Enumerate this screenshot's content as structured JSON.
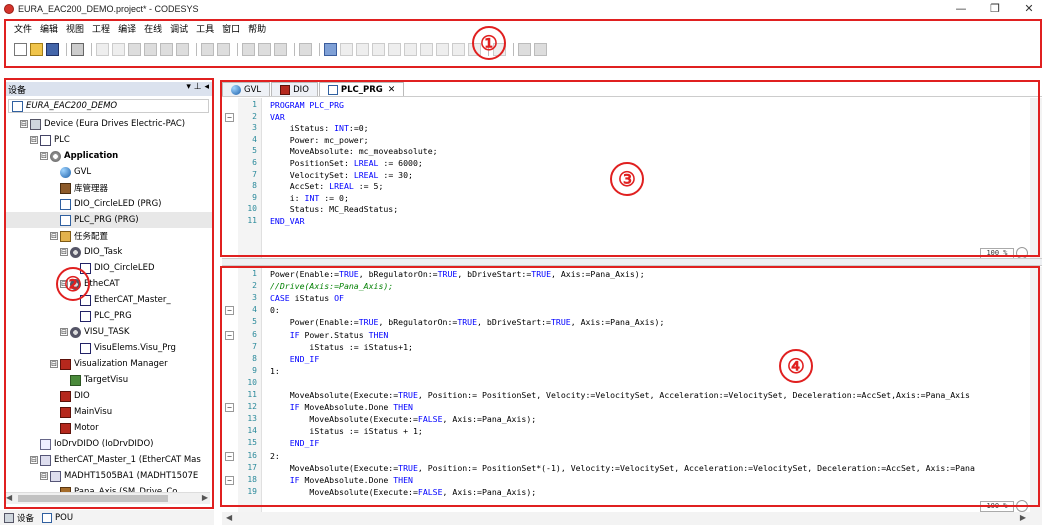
{
  "window": {
    "title": "EURA_EAC200_DEMO.project* - CODESYS",
    "min_glyph": "—",
    "max_glyph": "❐",
    "close_glyph": "✕"
  },
  "menu": [
    "文件",
    "编辑",
    "视图",
    "工程",
    "编译",
    "在线",
    "调试",
    "工具",
    "窗口",
    "帮助"
  ],
  "annotations": [
    "①",
    "②",
    "③",
    "④"
  ],
  "devices_panel": {
    "title": "设备",
    "header_buttons": "▾ ⊥ ◂",
    "root": "EURA_EAC200_DEMO",
    "tree": [
      {
        "label": "Device (Eura Drives Electric-PAC)",
        "level": 1,
        "icon": "device-icon",
        "exp": "⊟"
      },
      {
        "label": "PLC",
        "level": 2,
        "icon": "plc-icon",
        "exp": "⊟"
      },
      {
        "label": "Application",
        "level": 3,
        "icon": "application-icon",
        "exp": "⊟",
        "bold": true
      },
      {
        "label": "GVL",
        "level": 4,
        "icon": "globe-icon",
        "exp": ""
      },
      {
        "label": "库管理器",
        "level": 4,
        "icon": "library-icon",
        "exp": ""
      },
      {
        "label": "DIO_CircleLED (PRG)",
        "level": 4,
        "icon": "pou-icon",
        "exp": ""
      },
      {
        "label": "PLC_PRG (PRG)",
        "level": 4,
        "icon": "pou-icon",
        "exp": "",
        "selected": true
      },
      {
        "label": "任务配置",
        "level": 4,
        "icon": "task-config-icon",
        "exp": "⊟"
      },
      {
        "label": "DIO_Task",
        "level": 5,
        "icon": "task-gear-icon",
        "exp": "⊟"
      },
      {
        "label": "DIO_CircleLED",
        "level": 6,
        "icon": "program-call-icon",
        "exp": ""
      },
      {
        "label": "EtheCAT",
        "level": 5,
        "icon": "task-gear-icon",
        "exp": "⊟"
      },
      {
        "label": "EtherCAT_Master_",
        "level": 6,
        "icon": "program-call-icon",
        "exp": ""
      },
      {
        "label": "PLC_PRG",
        "level": 6,
        "icon": "program-call-icon",
        "exp": ""
      },
      {
        "label": "VISU_TASK",
        "level": 5,
        "icon": "task-gear-icon",
        "exp": "⊟"
      },
      {
        "label": "VisuElems.Visu_Prg",
        "level": 6,
        "icon": "program-call-icon",
        "exp": ""
      },
      {
        "label": "Visualization Manager",
        "level": 4,
        "icon": "visu-manager-icon",
        "exp": "⊟"
      },
      {
        "label": "TargetVisu",
        "level": 5,
        "icon": "target-visu-icon",
        "exp": ""
      },
      {
        "label": "DIO",
        "level": 4,
        "icon": "visu-icon",
        "exp": ""
      },
      {
        "label": "MainVisu",
        "level": 4,
        "icon": "visu-icon",
        "exp": ""
      },
      {
        "label": "Motor",
        "level": 4,
        "icon": "visu-icon",
        "exp": ""
      },
      {
        "label": "IoDrvDIDO (IoDrvDIDO)",
        "level": 2,
        "icon": "io-driver-icon",
        "exp": ""
      },
      {
        "label": "EtherCAT_Master_1 (EtherCAT Mas",
        "level": 2,
        "icon": "ethercat-master-icon",
        "exp": "⊟"
      },
      {
        "label": "MADHT1505BA1 (MADHT1507E",
        "level": 3,
        "icon": "ethercat-slave-icon",
        "exp": "⊟"
      },
      {
        "label": "Pana_Axis (SM_Drive_Co",
        "level": 4,
        "icon": "axis-icon",
        "exp": ""
      }
    ],
    "bottom_tabs": [
      {
        "label": "设备",
        "icon": "devices-tab-icon"
      },
      {
        "label": "POU",
        "icon": "pou-tab-icon"
      }
    ]
  },
  "editor": {
    "tabs": [
      {
        "label": "GVL",
        "icon": "globe-icon",
        "active": false
      },
      {
        "label": "DIO",
        "icon": "visu-icon",
        "active": false
      },
      {
        "label": "PLC_PRG",
        "icon": "pou-icon",
        "active": true,
        "close": "✕"
      }
    ],
    "decl_zoom": "100 %",
    "impl_zoom": "100 %",
    "declaration_lines": [
      [
        {
          "t": "PROGRAM PLC_PRG",
          "c": "kw"
        }
      ],
      [
        {
          "t": "VAR",
          "c": "kw"
        }
      ],
      [
        {
          "t": "    iStatus: ",
          "c": ""
        },
        {
          "t": "INT",
          "c": "kw"
        },
        {
          "t": ":=0;",
          "c": ""
        }
      ],
      [
        {
          "t": "    Power: mc_power;",
          "c": ""
        }
      ],
      [
        {
          "t": "    MoveAbsolute: mc_moveabsolute;",
          "c": ""
        }
      ],
      [
        {
          "t": "    PositionSet: ",
          "c": ""
        },
        {
          "t": "LREAL",
          "c": "kw"
        },
        {
          "t": " := 6000;",
          "c": ""
        }
      ],
      [
        {
          "t": "    VelocitySet: ",
          "c": ""
        },
        {
          "t": "LREAL",
          "c": "kw"
        },
        {
          "t": " := 30;",
          "c": ""
        }
      ],
      [
        {
          "t": "    AccSet: ",
          "c": ""
        },
        {
          "t": "LREAL",
          "c": "kw"
        },
        {
          "t": " := 5;",
          "c": ""
        }
      ],
      [
        {
          "t": "    i: ",
          "c": ""
        },
        {
          "t": "INT",
          "c": "kw"
        },
        {
          "t": " := 0;",
          "c": ""
        }
      ],
      [
        {
          "t": "    Status: MC_ReadStatus;",
          "c": ""
        }
      ],
      [
        {
          "t": "END_VAR",
          "c": "kw"
        }
      ]
    ],
    "implementation_lines": [
      [
        {
          "t": "Power(Enable:=",
          "c": ""
        },
        {
          "t": "TRUE",
          "c": "kw"
        },
        {
          "t": ", bRegulatorOn:=",
          "c": ""
        },
        {
          "t": "TRUE",
          "c": "kw"
        },
        {
          "t": ", bDriveStart:=",
          "c": ""
        },
        {
          "t": "TRUE",
          "c": "kw"
        },
        {
          "t": ", Axis:=Pana_Axis);",
          "c": ""
        }
      ],
      [
        {
          "t": "//Drive(Axis:=Pana_Axis);",
          "c": "cm"
        }
      ],
      [
        {
          "t": "CASE",
          "c": "kw"
        },
        {
          "t": " iStatus ",
          "c": ""
        },
        {
          "t": "OF",
          "c": "kw"
        }
      ],
      [
        {
          "t": "0:",
          "c": ""
        }
      ],
      [
        {
          "t": "    Power(Enable:=",
          "c": ""
        },
        {
          "t": "TRUE",
          "c": "kw"
        },
        {
          "t": ", bRegulatorOn:=",
          "c": ""
        },
        {
          "t": "TRUE",
          "c": "kw"
        },
        {
          "t": ", bDriveStart:=",
          "c": ""
        },
        {
          "t": "TRUE",
          "c": "kw"
        },
        {
          "t": ", Axis:=Pana_Axis);",
          "c": ""
        }
      ],
      [
        {
          "t": "    ",
          "c": ""
        },
        {
          "t": "IF",
          "c": "kw"
        },
        {
          "t": " Power.Status ",
          "c": ""
        },
        {
          "t": "THEN",
          "c": "kw"
        }
      ],
      [
        {
          "t": "        iStatus := iStatus+1;",
          "c": ""
        }
      ],
      [
        {
          "t": "    ",
          "c": ""
        },
        {
          "t": "END_IF",
          "c": "kw"
        }
      ],
      [
        {
          "t": "1:",
          "c": ""
        }
      ],
      [
        {
          "t": "",
          "c": ""
        }
      ],
      [
        {
          "t": "    MoveAbsolute(Execute:=",
          "c": ""
        },
        {
          "t": "TRUE",
          "c": "kw"
        },
        {
          "t": ", Position:= PositionSet, Velocity:=VelocitySet, Acceleration:=VelocitySet, Deceleration:=AccSet,Axis:=Pana_Axis",
          "c": ""
        }
      ],
      [
        {
          "t": "    ",
          "c": ""
        },
        {
          "t": "IF",
          "c": "kw"
        },
        {
          "t": " MoveAbsolute.Done ",
          "c": ""
        },
        {
          "t": "THEN",
          "c": "kw"
        }
      ],
      [
        {
          "t": "        MoveAbsolute(Execute:=",
          "c": ""
        },
        {
          "t": "FALSE",
          "c": "kw"
        },
        {
          "t": ", Axis:=Pana_Axis);",
          "c": ""
        }
      ],
      [
        {
          "t": "        iStatus := iStatus + 1;",
          "c": ""
        }
      ],
      [
        {
          "t": "    ",
          "c": ""
        },
        {
          "t": "END_IF",
          "c": "kw"
        }
      ],
      [
        {
          "t": "2:",
          "c": ""
        }
      ],
      [
        {
          "t": "    MoveAbsolute(Execute:=",
          "c": ""
        },
        {
          "t": "TRUE",
          "c": "kw"
        },
        {
          "t": ", Position:= PositionSet*(-1), Velocity:=VelocitySet, Acceleration:=VelocitySet, Deceleration:=AccSet, Axis:=Pana",
          "c": ""
        }
      ],
      [
        {
          "t": "    ",
          "c": ""
        },
        {
          "t": "IF",
          "c": "kw"
        },
        {
          "t": " MoveAbsolute.Done ",
          "c": ""
        },
        {
          "t": "THEN",
          "c": "kw"
        }
      ],
      [
        {
          "t": "        MoveAbsolute(Execute:=",
          "c": ""
        },
        {
          "t": "FALSE",
          "c": "kw"
        },
        {
          "t": ", Axis:=Pana_Axis);",
          "c": ""
        }
      ]
    ]
  }
}
